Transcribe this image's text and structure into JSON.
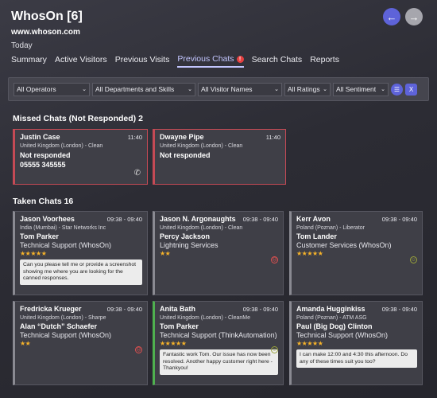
{
  "header": {
    "title": "WhosOn [6]",
    "site": "www.whoson.com",
    "period": "Today"
  },
  "nav": {
    "back_icon": "arrow-left-icon",
    "forward_icon": "arrow-right-icon",
    "back_glyph": "←",
    "forward_glyph": "→"
  },
  "tabs": [
    {
      "label": "Summary"
    },
    {
      "label": "Active Visitors"
    },
    {
      "label": "Previous Visits"
    },
    {
      "label": "Previous Chats",
      "badge": "!"
    },
    {
      "label": "Search Chats"
    },
    {
      "label": "Reports"
    }
  ],
  "filters": {
    "operators": "All Operators",
    "departments": "All Departments and Skills",
    "visitors": "All Visitor Names",
    "ratings": "All Ratings",
    "sentiment": "All Sentiment",
    "chevron": "⌄",
    "list_icon": "☰",
    "excel_icon": "X"
  },
  "missed": {
    "title": "Missed Chats (Not Responded) 2",
    "cards": [
      {
        "name": "Justin Case",
        "time": "11:40",
        "location": "United Kingdom (London) - Clean",
        "status": "Not responded",
        "phone": "05555 345555"
      },
      {
        "name": "Dwayne Pipe",
        "time": "11:40",
        "location": "United Kingdom (London) - Clean",
        "status": "Not responded"
      }
    ]
  },
  "taken": {
    "title": "Taken Chats 16",
    "cards": [
      {
        "name": "Jason Voorhees",
        "time": "09:38 - 09:40",
        "location": "India (Mumbai) - Star Networks Inc",
        "agent": "Tom Parker",
        "dept": "Technical Support (WhosOn)",
        "stars": "★★★★★",
        "message": "Can you please tell me or provide a screenshot showing me where you are looking for the canned responses."
      },
      {
        "name": "Jason N. Argonaughts",
        "time": "09:38 - 09:40",
        "location": "United Kingdom (London) - Clean",
        "agent": "Percy Jackson",
        "dept": "Lightning Services",
        "stars": "★★",
        "sentiment": "sad"
      },
      {
        "name": "Kerr Avon",
        "time": "09:38 - 09:40",
        "location": "Poland (Poznan) - Liberator",
        "agent": "Tom Lander",
        "dept": "Customer Services (WhosOn)",
        "stars": "★★★★★",
        "sentiment": "happy"
      },
      {
        "name": "Fredricka Krueger",
        "time": "09:38 - 09:40",
        "location": "United Kingdom (London) - Sharpe",
        "agent": "Alan “Dutch” Schaefer",
        "dept": "Technical Support (WhosOn)",
        "stars": "★★",
        "sentiment": "sad"
      },
      {
        "name": "Anita Bath",
        "time": "09:38 - 09:40",
        "location": "United Kingdom (London) - CleanMe",
        "agent": "Tom Parker",
        "dept": "Technical Support (ThinkAutomation)",
        "stars": "★★★★★",
        "sentiment": "happy",
        "message": "Fantastic work Tom. Our issue has now been resolved. Another happy customer right here - Thankyou!"
      },
      {
        "name": "Amanda Hugginkiss",
        "time": "09:38 - 09:40",
        "location": "Poland (Poznan) - ATM ASG",
        "agent": "Paul (Big Dog) Clinton",
        "dept": "Technical Support (WhosOn)",
        "stars": "★★★★★",
        "message": "I can make 12:00 and 4:30 this afternoon. Do any of these times suit you too?"
      }
    ]
  },
  "icons": {
    "phone": "phone-icon",
    "phone_glyph": "✆",
    "sad": "sad-face-icon",
    "sad_glyph": "☹",
    "happy": "happy-face-icon",
    "happy_glyph": "☺"
  },
  "colors": {
    "accent": "#5e63d9",
    "missed": "#c44a55",
    "star": "#f5b22a",
    "positive": "#4fb04f"
  }
}
